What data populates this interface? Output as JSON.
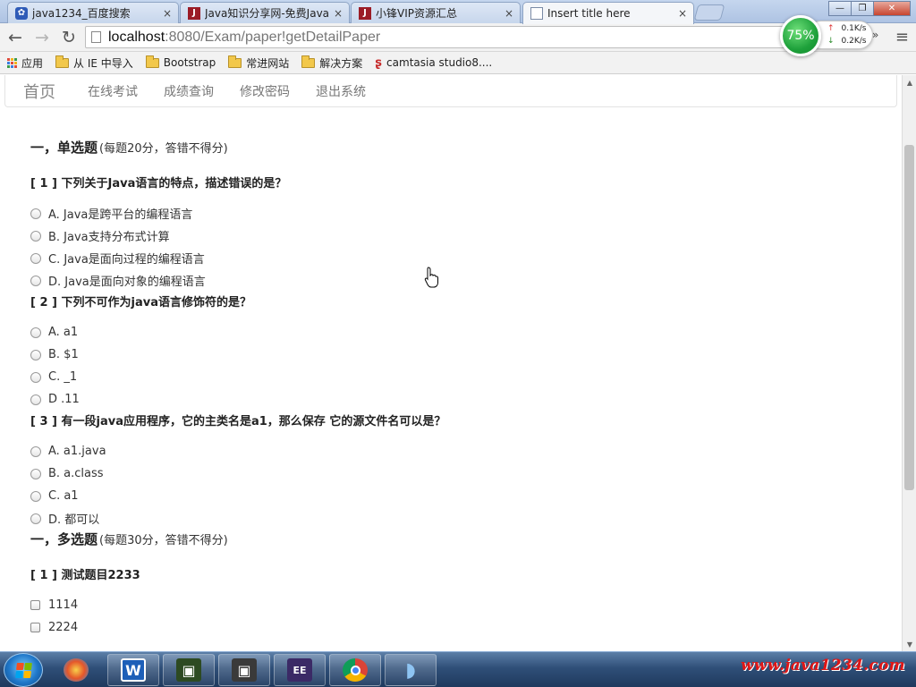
{
  "browser": {
    "tabs": [
      {
        "title": "java1234_百度搜索",
        "favicon": "paw-icon",
        "active": false
      },
      {
        "title": "Java知识分享网-免费Java",
        "favicon": "j-icon",
        "active": false
      },
      {
        "title": "小锋VIP资源汇总",
        "favicon": "j-icon",
        "active": false
      },
      {
        "title": "Insert title here",
        "favicon": "page-icon",
        "active": true
      }
    ],
    "close_glyph": "×",
    "window_buttons": {
      "minimize": "—",
      "maximize": "❐",
      "close": "✕"
    },
    "nav": {
      "back": "←",
      "forward": "→",
      "reload": "↻",
      "menu": "≡",
      "overflow": "»"
    },
    "url": {
      "host": "localhost",
      "rest": ":8080/Exam/paper!getDetailPaper"
    }
  },
  "speed_widget": {
    "percent": "75%",
    "up_rate": "0.1K/s",
    "down_rate": "0.2K/s",
    "up_arrow": "↑",
    "down_arrow": "↓",
    "color": "#1ea13b"
  },
  "bookmarks": [
    {
      "label": "应用",
      "icon": "apps-grid-icon"
    },
    {
      "label": "从 IE 中导入",
      "icon": "folder-icon"
    },
    {
      "label": "Bootstrap",
      "icon": "folder-icon"
    },
    {
      "label": "常进网站",
      "icon": "folder-icon"
    },
    {
      "label": "解决方案",
      "icon": "folder-icon"
    },
    {
      "label": "camtasia studio8....",
      "icon": "camtasia-icon"
    }
  ],
  "site_nav": {
    "brand": "首页",
    "items": [
      "在线考试",
      "成绩查询",
      "修改密码",
      "退出系统"
    ]
  },
  "paper": {
    "single_choice": {
      "title": "一，单选题",
      "note": "(每题20分，答错不得分)",
      "questions": [
        {
          "text": "[ 1 ] 下列关于Java语言的特点，描述错误的是？",
          "options": [
            "A. Java是跨平台的编程语言",
            "B. Java支持分布式计算",
            "C. Java是面向过程的编程语言",
            "D. Java是面向对象的编程语言"
          ]
        },
        {
          "text": "[ 2 ] 下列不可作为java语言修饰符的是？",
          "options": [
            "A. a1",
            "B. $1",
            "C. _1",
            "D .11"
          ]
        },
        {
          "text": "[ 3 ] 有一段java应用程序，它的主类名是a1，那么保存 它的源文件名可以是？",
          "options": [
            "A. a1.java",
            "B. a.class",
            "C. a1",
            "D. 都可以"
          ]
        }
      ]
    },
    "multi_choice": {
      "title": "一，多选题",
      "note": "(每题30分，答错不得分)",
      "questions": [
        {
          "text": "[ 1 ] 测试题目2233",
          "options": [
            "1114",
            "2224"
          ]
        }
      ]
    }
  },
  "scrollbar": {
    "up": "▲",
    "down": "▼"
  },
  "taskbar": {
    "apps": [
      {
        "name": "wps-writer",
        "glyph": "W",
        "color": "#1d5fb8"
      },
      {
        "name": "terminal-app",
        "glyph": "▣",
        "color": "#3d6b2a"
      },
      {
        "name": "terminal-app-2",
        "glyph": "▣",
        "color": "#4a4a4a"
      },
      {
        "name": "java-ee-ide",
        "glyph": "EE",
        "color": "#3b2a66"
      },
      {
        "name": "chrome",
        "glyph": "◉",
        "color": "#d8432f"
      },
      {
        "name": "dolphin-app",
        "glyph": "◗",
        "color": "#3a78c8"
      }
    ],
    "watermark": "www.java1234.com"
  }
}
